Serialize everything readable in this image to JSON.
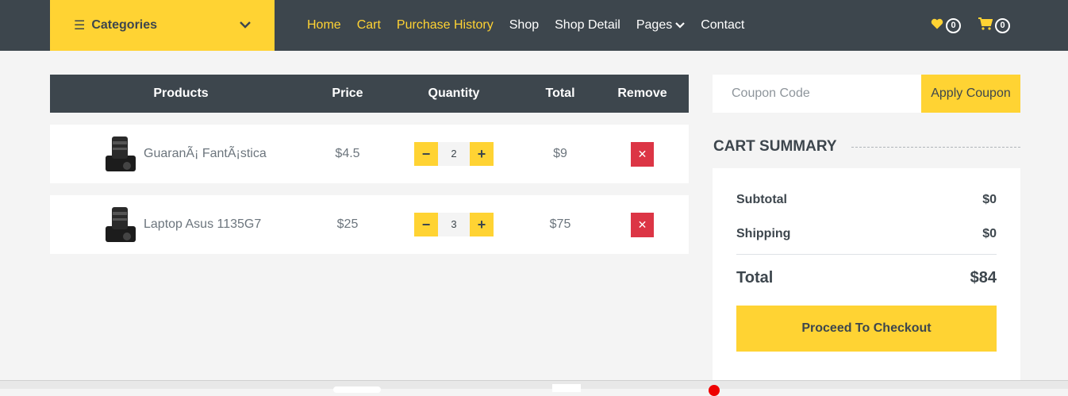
{
  "header": {
    "categories_label": "Categories",
    "nav": [
      {
        "label": "Home",
        "active": true
      },
      {
        "label": "Cart",
        "active": true
      },
      {
        "label": "Purchase History",
        "active": true
      },
      {
        "label": "Shop",
        "active": false
      },
      {
        "label": "Shop Detail",
        "active": false
      },
      {
        "label": "Pages",
        "active": false
      },
      {
        "label": "Contact",
        "active": false
      }
    ],
    "wishlist_count": "0",
    "cart_count": "0",
    "icons": {
      "menu": "bars-icon",
      "wishlist": "heart-icon",
      "cart": "shopping-cart-icon"
    }
  },
  "cart_table": {
    "headers": [
      "Products",
      "Price",
      "Quantity",
      "Total",
      "Remove"
    ],
    "rows": [
      {
        "product": "GuaranÃ¡ FantÃ¡stica",
        "price": "$4.5",
        "quantity": "2",
        "total": "$9"
      },
      {
        "product": "Laptop Asus 1135G7",
        "price": "$25",
        "quantity": "3",
        "total": "$75"
      }
    ]
  },
  "coupon": {
    "placeholder": "Coupon Code",
    "button": "Apply Coupon"
  },
  "summary": {
    "title": "Cart Summary",
    "subtitle_label": "Subtotal",
    "subtotal": "$0",
    "shipping_label": "Shipping",
    "shipping": "$0",
    "total_label": "Total",
    "total": "$84",
    "checkout_label": "Proceed To Checkout"
  },
  "colors": {
    "accent": "#ffd333",
    "dark": "#3d464d",
    "danger": "#dc3545",
    "background": "#f4f4f4"
  }
}
